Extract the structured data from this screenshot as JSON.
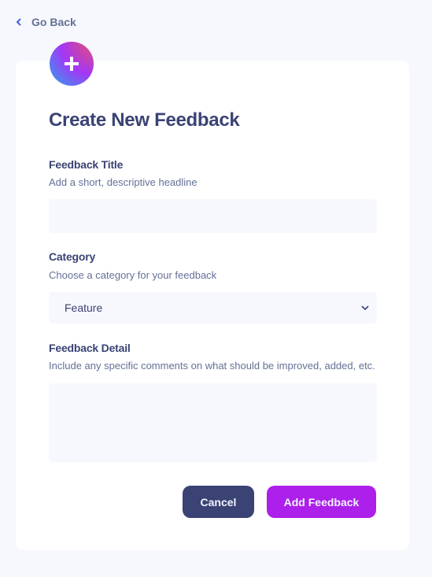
{
  "nav": {
    "back_label": "Go Back"
  },
  "form": {
    "title": "Create New Feedback",
    "feedback_title": {
      "label": "Feedback Title",
      "hint": "Add a short, descriptive headline",
      "value": ""
    },
    "category": {
      "label": "Category",
      "hint": "Choose a category for your feedback",
      "selected": "Feature"
    },
    "detail": {
      "label": "Feedback Detail",
      "hint": "Include any specific comments on what should be improved, added, etc.",
      "value": ""
    },
    "cancel_label": "Cancel",
    "submit_label": "Add Feedback"
  },
  "icons": {
    "back": "chevron-left-icon",
    "badge": "plus-icon",
    "select": "chevron-down-icon"
  },
  "colors": {
    "primary": "#ad1fea",
    "dark": "#3a4374",
    "muted": "#647196",
    "background": "#f7f8fd",
    "accent_blue": "#4661e6"
  }
}
